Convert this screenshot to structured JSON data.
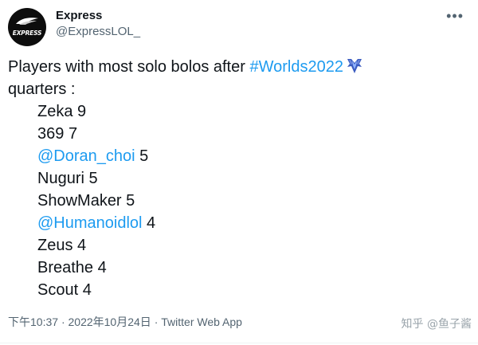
{
  "author": {
    "name": "Express",
    "handle": "@ExpressLOL_",
    "avatar_text": "EXPRESS"
  },
  "more_icon": "more-horizontal-icon",
  "tweet": {
    "intro_before": "Players with most solo bolos after ",
    "hashtag": "#Worlds2022",
    "intro_after": "quarters :",
    "players": [
      {
        "name": "Zeka",
        "count": "9",
        "mention": false
      },
      {
        "name": "369",
        "count": "7",
        "mention": false
      },
      {
        "name": "@Doran_choi",
        "count": "5",
        "mention": true
      },
      {
        "name": "Nuguri",
        "count": "5",
        "mention": false
      },
      {
        "name": "ShowMaker",
        "count": "5",
        "mention": false
      },
      {
        "name": "@Humanoidlol",
        "count": "4",
        "mention": true
      },
      {
        "name": "Zeus",
        "count": "4",
        "mention": false
      },
      {
        "name": "Breathe",
        "count": "4",
        "mention": false
      },
      {
        "name": "Scout",
        "count": "4",
        "mention": false
      }
    ]
  },
  "meta": {
    "time": "下午10:37",
    "separator": "·",
    "date": "2022年10月24日",
    "source": "Twitter Web App",
    "full": "下午10:37 · 2022年10月24日 · Twitter Web App"
  },
  "watermark": "知乎 @鱼子酱",
  "colors": {
    "link": "#1d9bf0",
    "text": "#0f1419",
    "muted": "#536471"
  }
}
